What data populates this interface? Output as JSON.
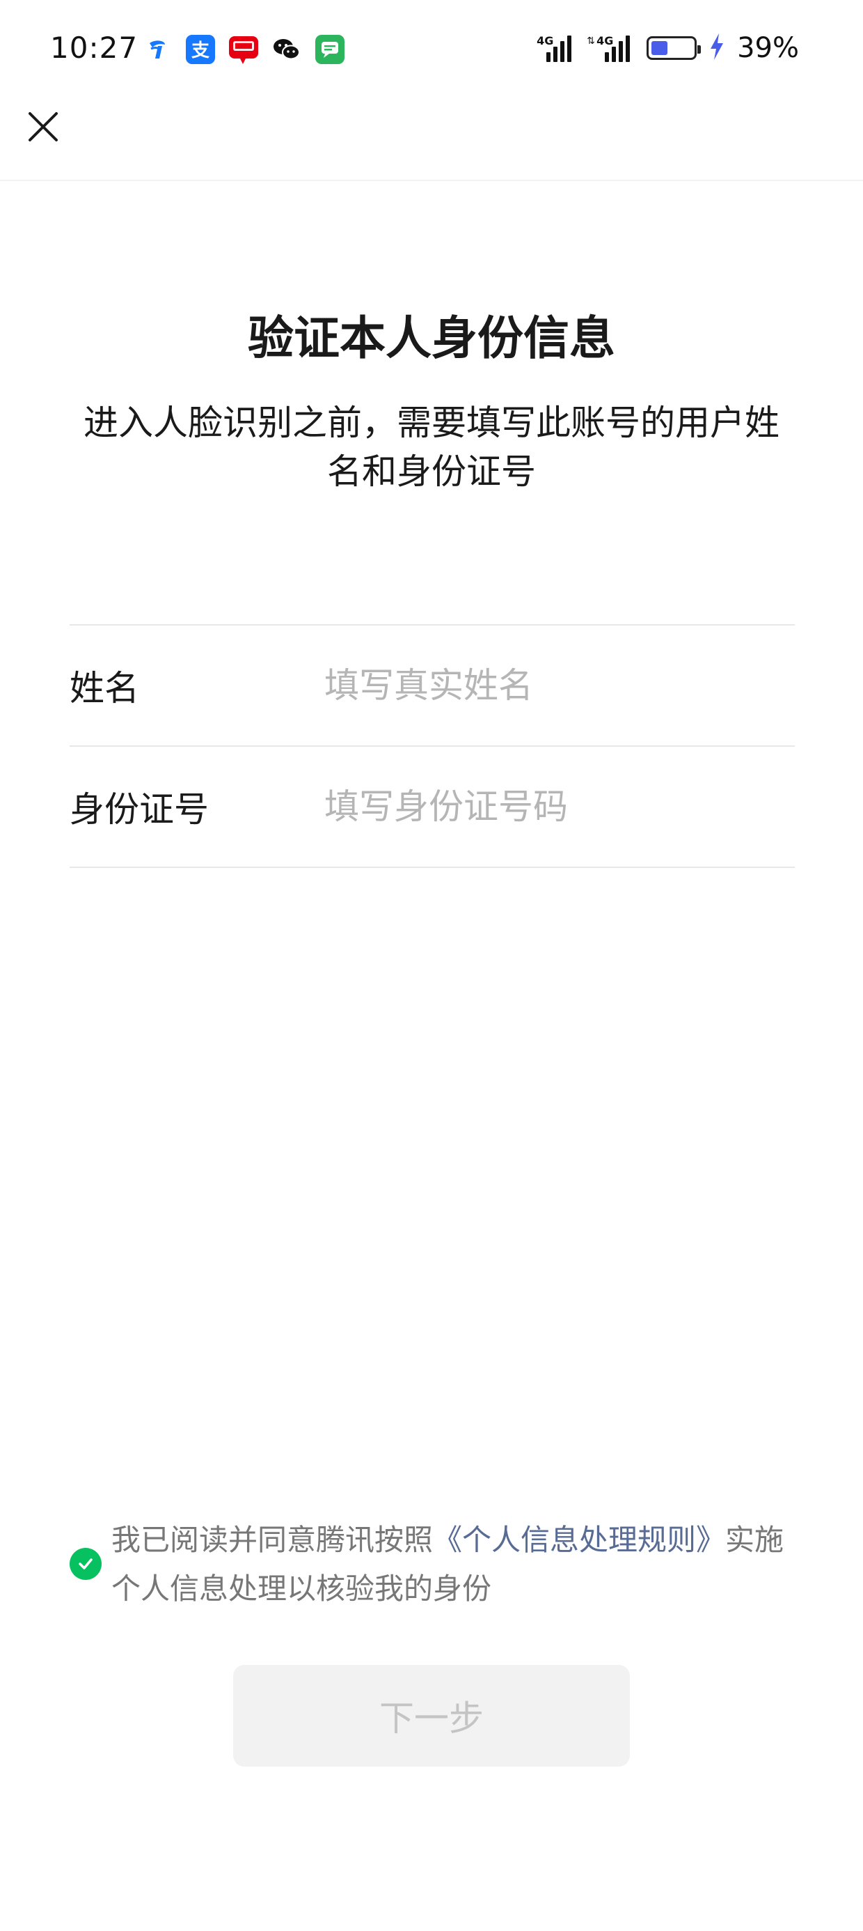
{
  "status_bar": {
    "time": "10:27",
    "battery_percent": "39%",
    "battery_level": 0.39,
    "network_1": "4G",
    "network_2": "4G",
    "app_icons": [
      "china-telecom-icon",
      "alipay-icon",
      "unionpay-icon",
      "wechat-icon",
      "messages-icon"
    ]
  },
  "nav": {
    "close_icon": "close-icon"
  },
  "header": {
    "title": "验证本人身份信息",
    "subtitle": "进入人脸识别之前，需要填写此账号的用户姓名和身份证号"
  },
  "form": {
    "name": {
      "label": "姓名",
      "placeholder": "填写真实姓名",
      "value": ""
    },
    "id_number": {
      "label": "身份证号",
      "placeholder": "填写身份证号码",
      "value": ""
    }
  },
  "agreement": {
    "checked": true,
    "text_before": "我已阅读并同意腾讯按照",
    "link_text": "《个人信息处理规则》",
    "text_after": "实施个人信息处理以核验我的身份"
  },
  "actions": {
    "next_label": "下一步"
  },
  "colors": {
    "accent_green": "#07c160",
    "link_blue": "#576b95",
    "battery_blue": "#4a5de8",
    "disabled_button_bg": "#f2f2f2",
    "disabled_button_text": "#c4c4c4"
  }
}
